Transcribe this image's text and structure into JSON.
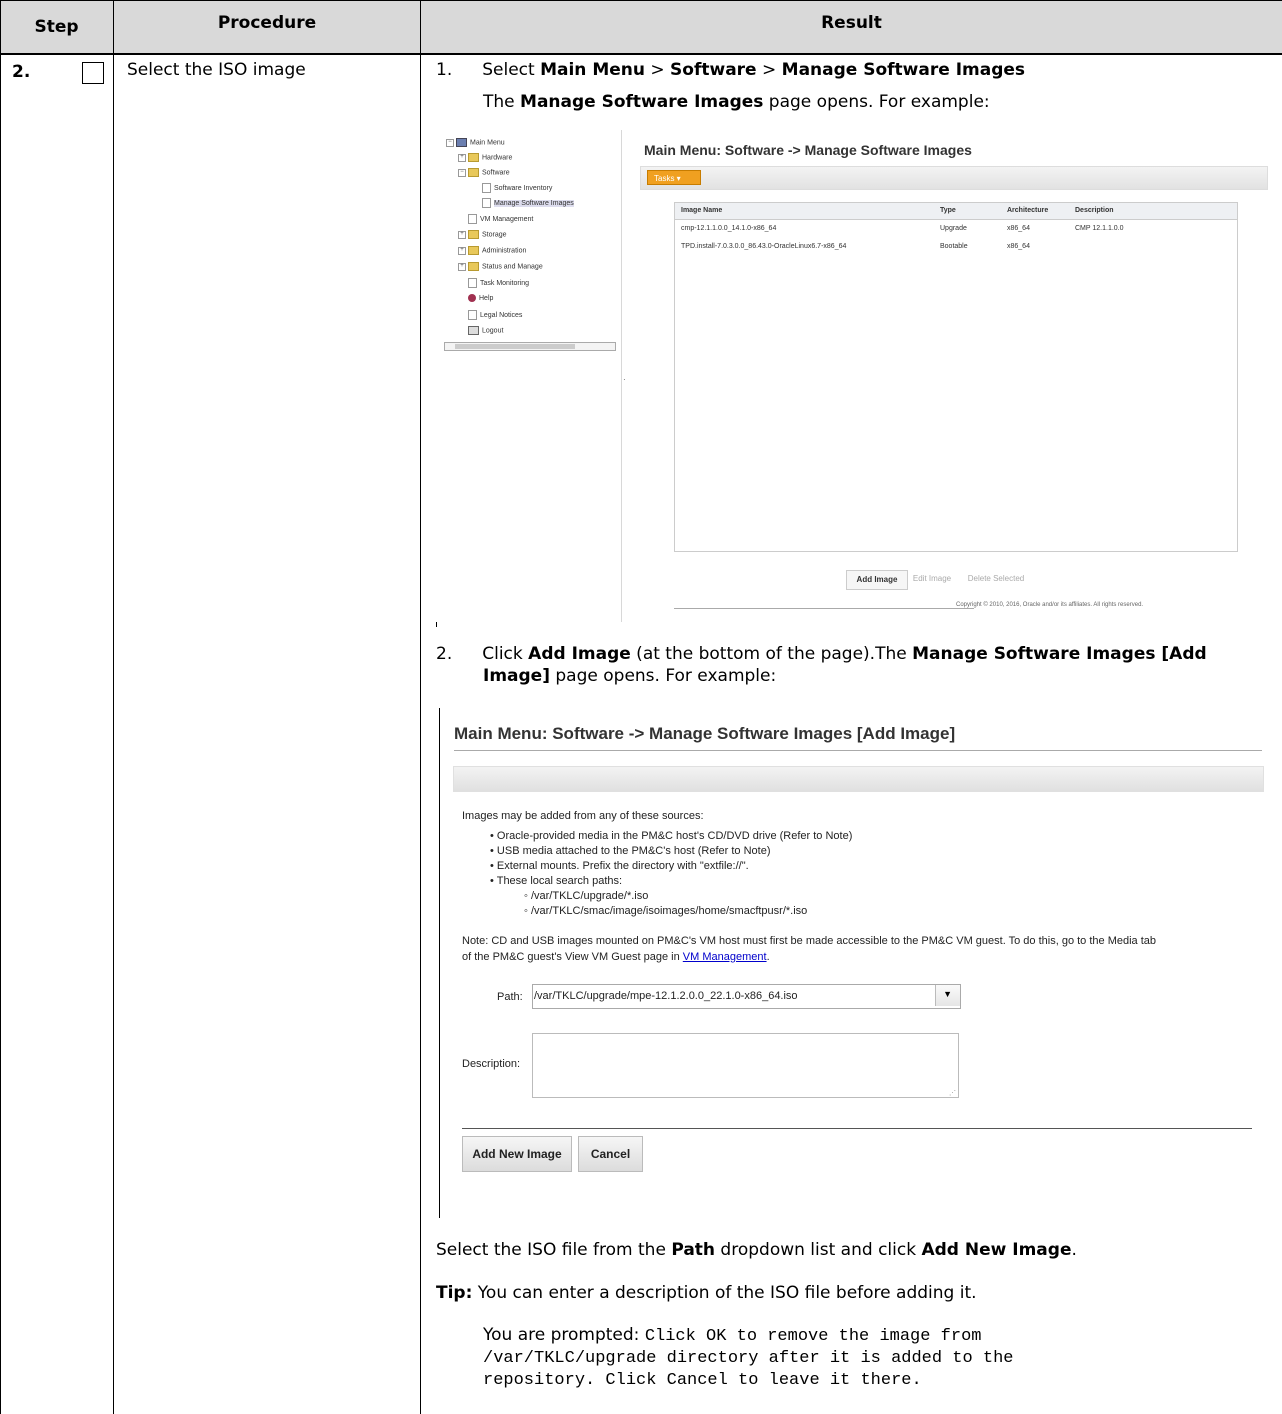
{
  "table": {
    "headers": {
      "step": "Step",
      "procedure": "Procedure",
      "result": "Result"
    },
    "step_number": "2.",
    "procedure_text": "Select the ISO image"
  },
  "result": {
    "item1": {
      "num": "1.",
      "p1": "Select ",
      "b1": "Main Menu",
      "p2": " > ",
      "b2": "Software",
      "p3": " > ",
      "b3": "Manage Software Images"
    },
    "item1_sub": {
      "p1": "The ",
      "b1": "Manage Software Images",
      "p2": " page opens. For example:"
    },
    "item2": {
      "num": "2.",
      "p1": "Click ",
      "b1": "Add Image",
      "p2": " (at the bottom of the page).The ",
      "b2": "Manage Software Images [Add",
      "b3": "Image]",
      "p3": " page opens. For example:"
    },
    "select_line": {
      "p1": "Select the ISO file from the ",
      "b1": "Path",
      "p2": " dropdown list and click ",
      "b2": "Add New Image",
      "p3": "."
    },
    "tip": {
      "b1": "Tip:",
      "p1": " You can enter a description of the ISO file before adding it."
    },
    "prompt": {
      "p1": "You are prompted: ",
      "m1": "Click OK to remove the image from",
      "m2": "/var/TKLC/upgrade directory after it is added to the",
      "m3": "repository. Click Cancel to leave it there."
    }
  },
  "screenshot1": {
    "tree": [
      {
        "label": "Main Menu",
        "kind": "root"
      },
      {
        "label": "Hardware",
        "kind": "folder"
      },
      {
        "label": "Software",
        "kind": "folder"
      },
      {
        "label": "Software Inventory",
        "kind": "page"
      },
      {
        "label": "Manage Software Images",
        "kind": "page"
      },
      {
        "label": "VM Management",
        "kind": "page"
      },
      {
        "label": "Storage",
        "kind": "folder"
      },
      {
        "label": "Administration",
        "kind": "folder"
      },
      {
        "label": "Status and Manage",
        "kind": "folder"
      },
      {
        "label": "Task Monitoring",
        "kind": "page"
      },
      {
        "label": "Help",
        "kind": "help"
      },
      {
        "label": "Legal Notices",
        "kind": "page"
      },
      {
        "label": "Logout",
        "kind": "logout"
      }
    ],
    "title": "Main Menu: Software -> Manage Software Images",
    "tasks_label": "Tasks",
    "columns": [
      "Image Name",
      "Type",
      "Architecture",
      "Description"
    ],
    "rows": [
      [
        "cmp-12.1.1.0.0_14.1.0-x86_64",
        "Upgrade",
        "x86_64",
        "CMP 12.1.1.0.0"
      ],
      [
        "TPD.install-7.0.3.0.0_86.43.0-OracleLinux6.7-x86_64",
        "Bootable",
        "x86_64",
        ""
      ]
    ],
    "buttons": {
      "add": "Add Image",
      "edit": "Edit Image",
      "delete": "Delete Selected"
    },
    "copyright": "Copyright © 2010, 2016, Oracle and/or its affiliates. All rights reserved."
  },
  "screenshot2": {
    "title": "Main Menu: Software -> Manage Software Images [Add Image]",
    "intro": "Images may be added from any of these sources:",
    "sources": [
      "Oracle-provided media in the PM&C host's CD/DVD drive (Refer to Note)",
      "USB media attached to the PM&C's host (Refer to Note)",
      "External mounts. Prefix the directory with \"extfile://\".",
      "These local search paths:"
    ],
    "paths": [
      "/var/TKLC/upgrade/*.iso",
      "/var/TKLC/smac/image/isoimages/home/smacftpusr/*.iso"
    ],
    "note_l1": "Note: CD and USB images mounted on PM&C's VM host must first be made accessible to the PM&C VM guest. To do this, go to the Media tab",
    "note_l2_pre": "of the PM&C guest's View VM Guest page in ",
    "note_link": "VM Management",
    "note_l2_post": ".",
    "path_label": "Path:",
    "path_value": "/var/TKLC/upgrade/mpe-12.1.2.0.0_22.1.0-x86_64.iso",
    "description_label": "Description:",
    "add_new_button": "Add New Image",
    "cancel_button": "Cancel"
  }
}
